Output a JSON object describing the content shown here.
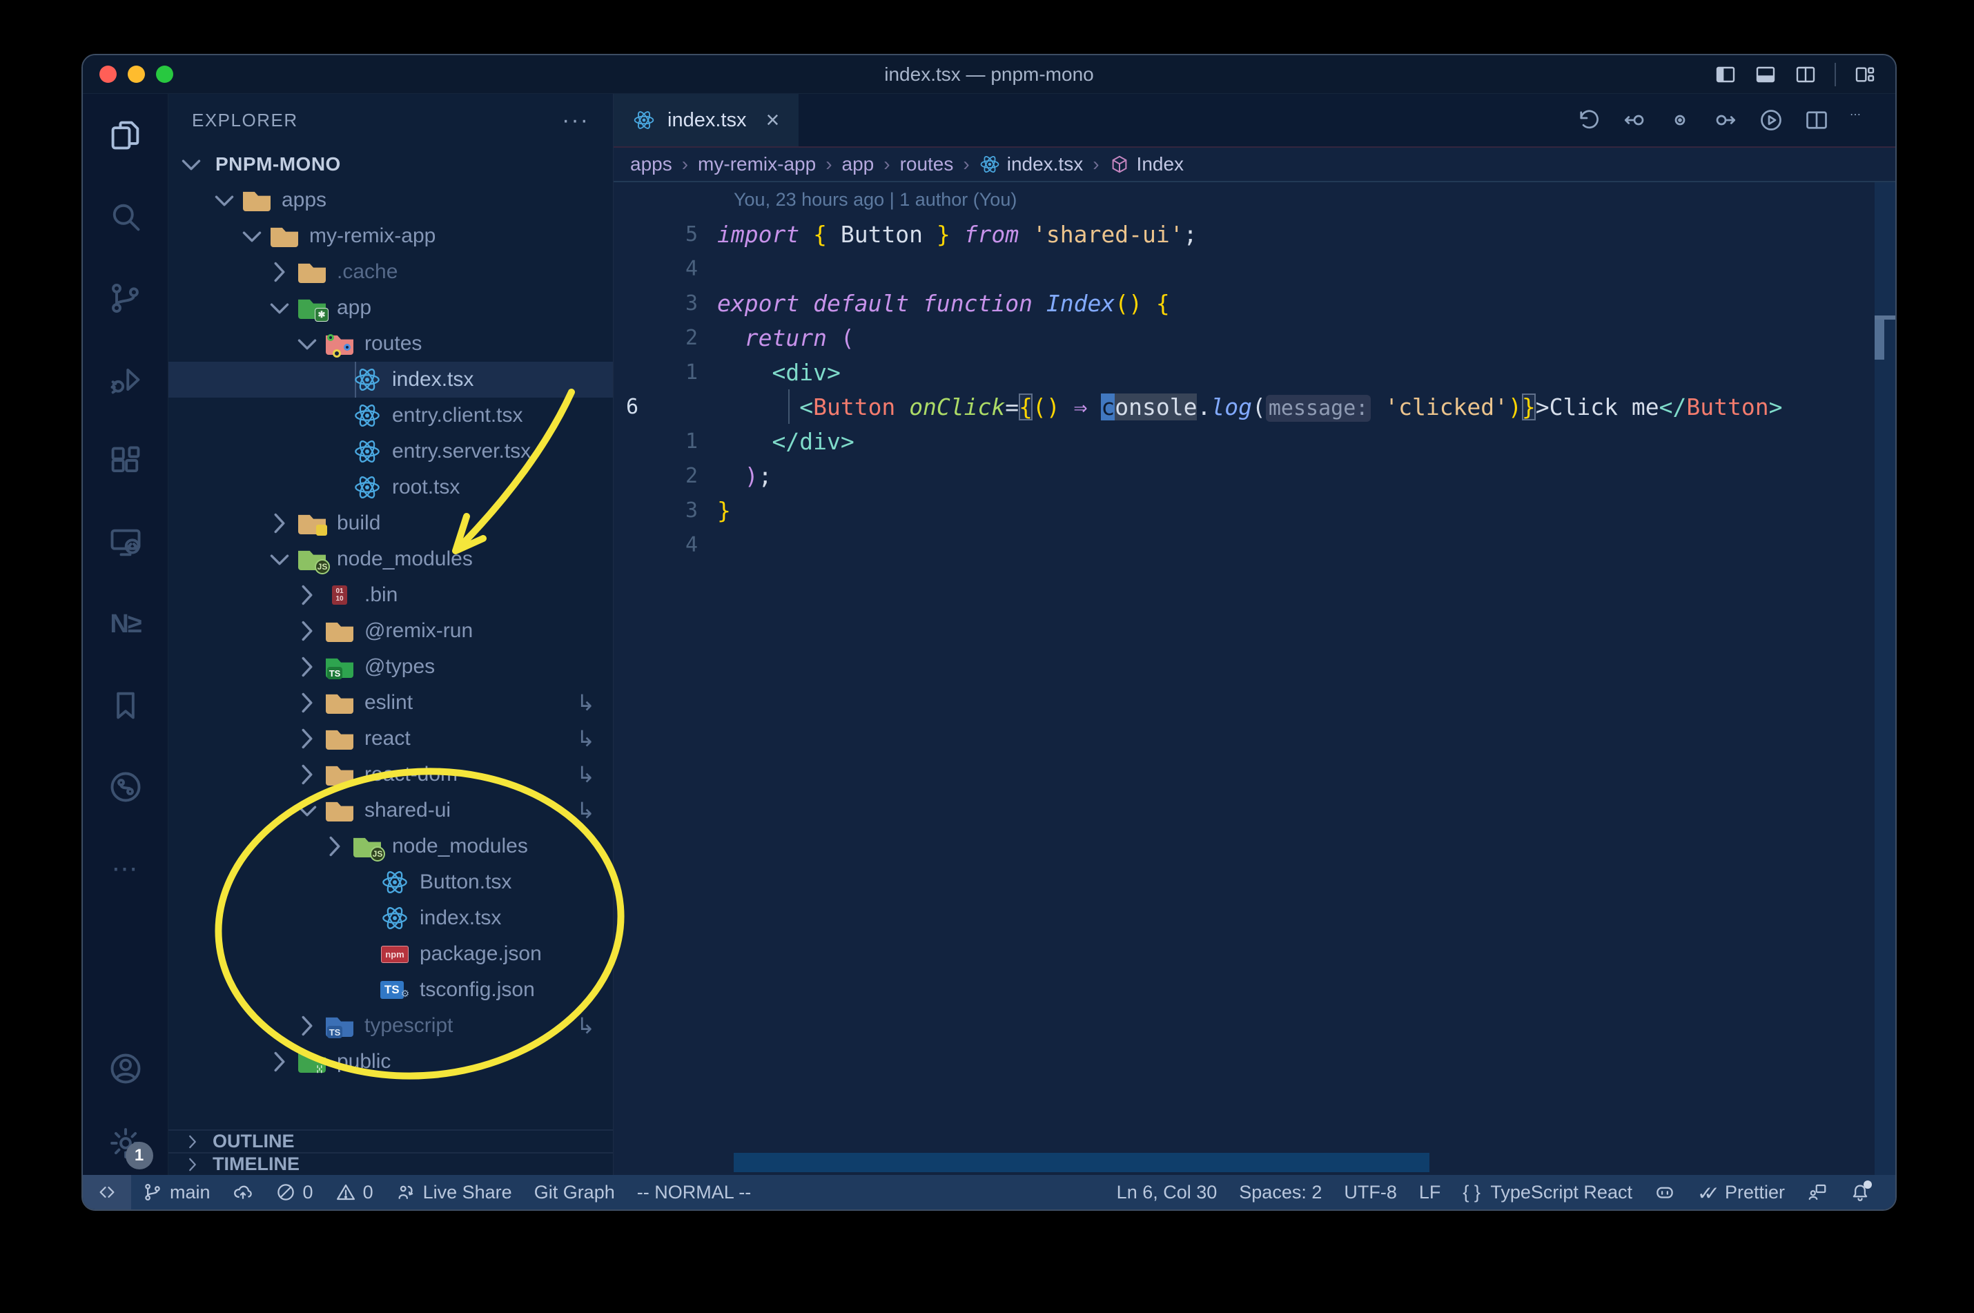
{
  "window": {
    "title": "index.tsx — pnpm-mono"
  },
  "activity_bar": {
    "items": [
      {
        "name": "explorer",
        "icon": "files",
        "active": true
      },
      {
        "name": "search",
        "icon": "search",
        "active": false
      },
      {
        "name": "source-control",
        "icon": "scm",
        "active": false
      },
      {
        "name": "run-debug",
        "icon": "debug",
        "active": false
      },
      {
        "name": "extensions",
        "icon": "extensions",
        "active": false
      },
      {
        "name": "remote-explorer",
        "icon": "remote-explorer",
        "active": false
      },
      {
        "name": "nx-console",
        "icon": "nx",
        "active": false
      },
      {
        "name": "bookmarks",
        "icon": "bookmark",
        "active": false
      },
      {
        "name": "git-graph-view",
        "icon": "gitgraph",
        "active": false
      },
      {
        "name": "additional-views",
        "icon": "more-h",
        "active": false
      }
    ],
    "bottom": [
      {
        "name": "accounts",
        "icon": "account",
        "badge": ""
      },
      {
        "name": "settings",
        "icon": "gear",
        "badge": "1"
      }
    ]
  },
  "sidebar": {
    "header": {
      "title": "EXPLORER",
      "more": "···"
    },
    "root": "PNPM-MONO",
    "tree": [
      {
        "label": "apps",
        "level": 1,
        "chevron": "open",
        "icon": "folder-tan"
      },
      {
        "label": "my-remix-app",
        "level": 2,
        "chevron": "open",
        "icon": "folder-tan"
      },
      {
        "label": ".cache",
        "level": 3,
        "chevron": "closed",
        "icon": "folder-tan",
        "dim": true
      },
      {
        "label": "app",
        "level": 3,
        "chevron": "open",
        "icon": "folder-app"
      },
      {
        "label": "routes",
        "level": 4,
        "chevron": "open",
        "icon": "folder-routes"
      },
      {
        "label": "index.tsx",
        "level": 5,
        "chevron": "none",
        "icon": "file-react",
        "selected": true
      },
      {
        "label": "entry.client.tsx",
        "level": 5,
        "chevron": "none",
        "icon": "file-react"
      },
      {
        "label": "entry.server.tsx",
        "level": 5,
        "chevron": "none",
        "icon": "file-react"
      },
      {
        "label": "root.tsx",
        "level": 5,
        "chevron": "none",
        "icon": "file-react"
      },
      {
        "label": "build",
        "level": 3,
        "chevron": "closed",
        "icon": "folder-build"
      },
      {
        "label": "node_modules",
        "level": 3,
        "chevron": "open",
        "icon": "folder-node"
      },
      {
        "label": ".bin",
        "level": 4,
        "chevron": "closed",
        "icon": "file-binary"
      },
      {
        "label": "@remix-run",
        "level": 4,
        "chevron": "closed",
        "icon": "folder-tan"
      },
      {
        "label": "@types",
        "level": 4,
        "chevron": "closed",
        "icon": "folder-types"
      },
      {
        "label": "eslint",
        "level": 4,
        "chevron": "closed",
        "icon": "folder-tan",
        "symlink": true
      },
      {
        "label": "react",
        "level": 4,
        "chevron": "closed",
        "icon": "folder-tan",
        "symlink": true
      },
      {
        "label": "react-dom",
        "level": 4,
        "chevron": "closed",
        "icon": "folder-tan",
        "symlink": true
      },
      {
        "label": "shared-ui",
        "level": 4,
        "chevron": "open",
        "icon": "folder-tan",
        "symlink": true
      },
      {
        "label": "node_modules",
        "level": 5,
        "chevron": "closed",
        "icon": "folder-node"
      },
      {
        "label": "Button.tsx",
        "level": 6,
        "chevron": "none",
        "icon": "file-react"
      },
      {
        "label": "index.tsx",
        "level": 6,
        "chevron": "none",
        "icon": "file-react"
      },
      {
        "label": "package.json",
        "level": 6,
        "chevron": "none",
        "icon": "file-npm"
      },
      {
        "label": "tsconfig.json",
        "level": 6,
        "chevron": "none",
        "icon": "file-ts"
      },
      {
        "label": "typescript",
        "level": 4,
        "chevron": "closed",
        "icon": "folder-ts-dim",
        "dim": true,
        "symlink": true
      },
      {
        "label": "public",
        "level": 3,
        "chevron": "closed",
        "icon": "folder-public"
      }
    ],
    "sections": [
      {
        "label": "OUTLINE"
      },
      {
        "label": "TIMELINE"
      }
    ]
  },
  "editor": {
    "tab": {
      "label": "index.tsx",
      "close": "×"
    },
    "actions": [
      {
        "name": "local-history",
        "icon": "history"
      },
      {
        "name": "nav-previous-change",
        "icon": "nav-back"
      },
      {
        "name": "nav-current",
        "icon": "nav-dot"
      },
      {
        "name": "nav-next-change",
        "icon": "nav-forward"
      },
      {
        "name": "run-file",
        "icon": "run"
      },
      {
        "name": "split-editor",
        "icon": "split"
      },
      {
        "name": "more-actions",
        "icon": "more-h"
      }
    ],
    "breadcrumbs": [
      {
        "label": "apps"
      },
      {
        "label": "my-remix-app"
      },
      {
        "label": "app"
      },
      {
        "label": "routes"
      },
      {
        "label": "index.tsx",
        "icon": "react-sm",
        "lite": true
      },
      {
        "label": "Index",
        "icon": "cube",
        "lite": true
      }
    ],
    "blame": "You, 23 hours ago | 1 author (You)",
    "code_lines": [
      {
        "num": "5",
        "tokens": [
          [
            "import",
            "kw"
          ],
          [
            " ",
            "fg"
          ],
          [
            "{",
            "y"
          ],
          [
            " Button ",
            "fg"
          ],
          [
            "}",
            "y"
          ],
          [
            " ",
            "fg"
          ],
          [
            "from",
            "kw"
          ],
          [
            " ",
            "fg"
          ],
          [
            "'shared-ui'",
            "str"
          ],
          [
            ";",
            "fg"
          ]
        ]
      },
      {
        "num": "4",
        "tokens": []
      },
      {
        "num": "3",
        "tokens": [
          [
            "export",
            "kw"
          ],
          [
            " ",
            "fg"
          ],
          [
            "default",
            "kw"
          ],
          [
            " ",
            "fg"
          ],
          [
            "function",
            "kw"
          ],
          [
            " ",
            "fg"
          ],
          [
            "Index",
            "fn"
          ],
          [
            "()",
            "y"
          ],
          [
            " ",
            "fg"
          ],
          [
            "{",
            "y"
          ]
        ]
      },
      {
        "num": "2",
        "tokens": [
          [
            "  ",
            "fg"
          ],
          [
            "return",
            "kw"
          ],
          [
            " ",
            "fg"
          ],
          [
            "(",
            "pk"
          ]
        ]
      },
      {
        "num": "1",
        "tokens": [
          [
            "    ",
            "fg"
          ],
          [
            "<div>",
            "tl"
          ]
        ]
      },
      {
        "num": "6",
        "current": true,
        "tokens": [
          [
            "      ",
            "fg"
          ],
          [
            "<",
            "tl"
          ],
          [
            "Button",
            "tag"
          ],
          [
            " ",
            "fg"
          ],
          [
            "onClick",
            "at"
          ],
          [
            "=",
            "fg"
          ],
          [
            "{",
            "bx"
          ],
          [
            "()",
            "y"
          ],
          [
            " ",
            "fg"
          ],
          [
            "⇒",
            "pk"
          ],
          [
            " ",
            "fg"
          ],
          [
            "c",
            "cur"
          ],
          [
            "onsole",
            "whl"
          ],
          [
            ".",
            "fg"
          ],
          [
            "log",
            "fn"
          ],
          [
            "(",
            "fg"
          ],
          [
            "message:",
            "inl"
          ],
          [
            " ",
            "fg"
          ],
          [
            "'clicked'",
            "str"
          ],
          [
            ")",
            "y"
          ],
          [
            "}",
            "bx"
          ],
          [
            ">",
            "fg"
          ],
          [
            "Click me",
            "fg"
          ],
          [
            "</",
            "tl"
          ],
          [
            "Button",
            "tag"
          ],
          [
            ">",
            "tl"
          ]
        ]
      },
      {
        "num": "1",
        "tokens": [
          [
            "    ",
            "fg"
          ],
          [
            "</div>",
            "tl"
          ]
        ]
      },
      {
        "num": "2",
        "tokens": [
          [
            "  ",
            "fg"
          ],
          [
            ")",
            "pk"
          ],
          [
            ";",
            "fg"
          ]
        ]
      },
      {
        "num": "3",
        "tokens": [
          [
            "}",
            "y"
          ]
        ]
      },
      {
        "num": "4",
        "tokens": []
      }
    ]
  },
  "status_bar": {
    "left": [
      {
        "name": "remote-indicator",
        "icon": "remote",
        "boxed": true
      },
      {
        "name": "git-branch",
        "icon": "branch",
        "label": "main"
      },
      {
        "name": "sync-changes",
        "icon": "cloud-up"
      },
      {
        "name": "errors",
        "icon": "err",
        "label": "0"
      },
      {
        "name": "warnings",
        "icon": "warn",
        "label": "0"
      },
      {
        "name": "live-share",
        "icon": "liveshare",
        "label": "Live Share"
      },
      {
        "name": "git-graph",
        "label": "Git Graph"
      },
      {
        "name": "vim-mode",
        "label": "-- NORMAL --"
      }
    ],
    "right": [
      {
        "name": "cursor-position",
        "label": "Ln 6, Col 30"
      },
      {
        "name": "indentation",
        "label": "Spaces: 2"
      },
      {
        "name": "encoding",
        "label": "UTF-8"
      },
      {
        "name": "eol",
        "label": "LF"
      },
      {
        "name": "language-mode",
        "icon": "braces",
        "label": "TypeScript React"
      },
      {
        "name": "copilot",
        "icon": "copilot"
      },
      {
        "name": "prettier",
        "icon": "checks",
        "label": "Prettier"
      },
      {
        "name": "feedback",
        "icon": "feedback"
      },
      {
        "name": "notifications",
        "icon": "bell",
        "dot": true
      }
    ]
  },
  "annotations": {
    "color": "#f5e63b"
  }
}
